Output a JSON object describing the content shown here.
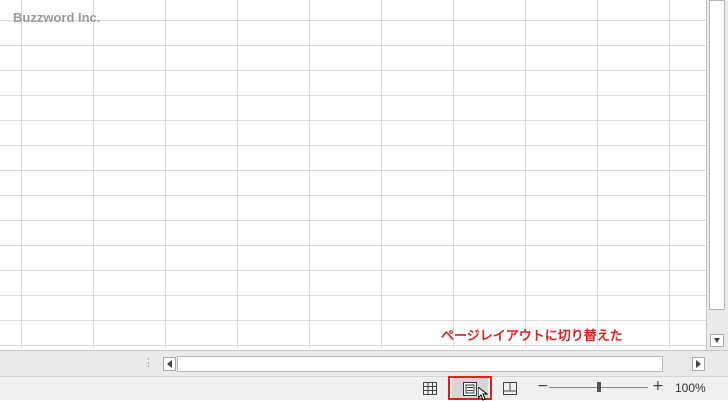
{
  "watermark": "Buzzword Inc.",
  "annotation": "ページレイアウトに切り替えた",
  "status_bar": {
    "views": [
      {
        "name": "normal-view",
        "icon": "grid-icon",
        "active": false
      },
      {
        "name": "page-layout-view",
        "icon": "page-layout-icon",
        "active": true
      },
      {
        "name": "page-break-preview",
        "icon": "page-break-icon",
        "active": false
      }
    ],
    "zoom_minus": "−",
    "zoom_plus": "+",
    "zoom_level": 100,
    "zoom_label": "100%"
  },
  "colors": {
    "annotation": "#e0201b",
    "highlight_box": "#e0201b",
    "watermark": "#9a9a9a"
  }
}
